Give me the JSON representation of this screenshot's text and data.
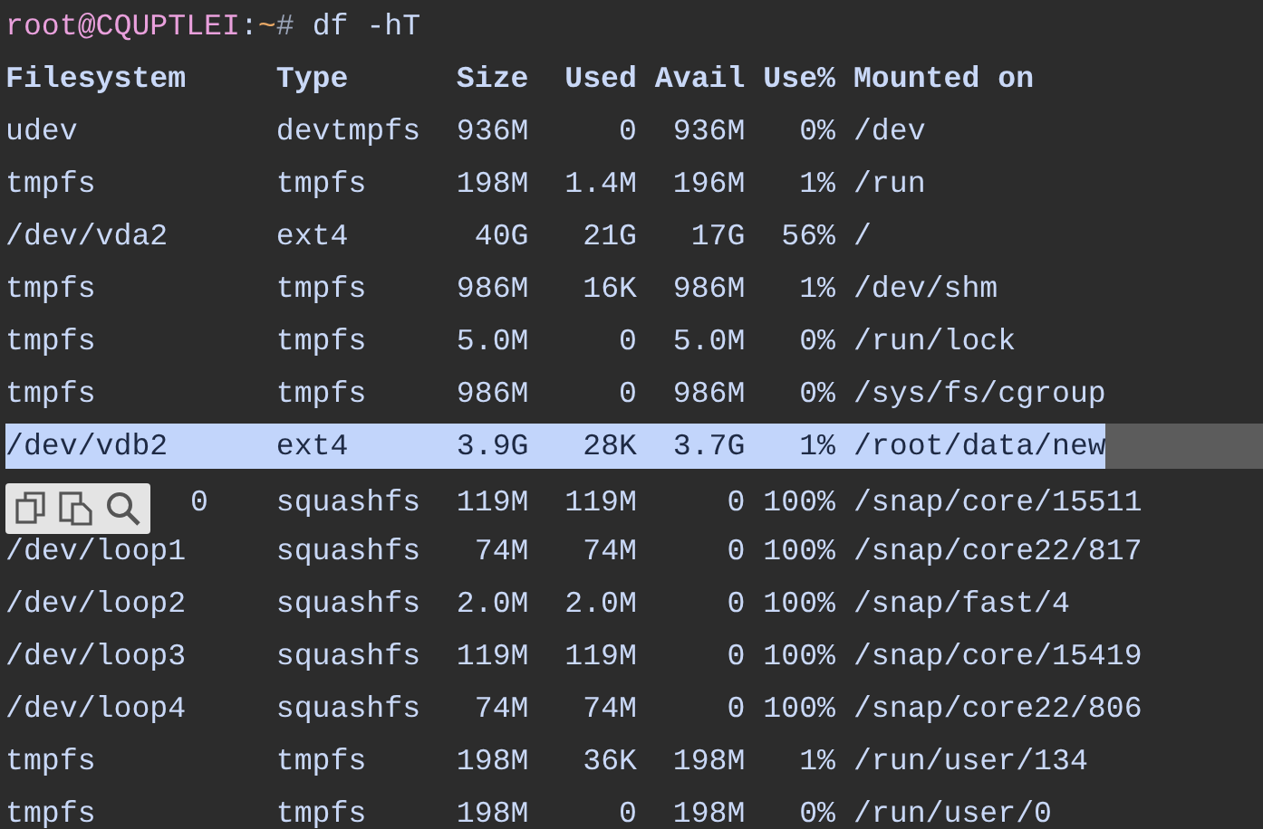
{
  "prompt": {
    "user_host": "root@CQUPTLEI",
    "separator": ":",
    "path": "~",
    "symbol": "#",
    "command": "df -hT"
  },
  "table": {
    "columns": [
      "Filesystem",
      "Type",
      "Size",
      "Used",
      "Avail",
      "Use%",
      "Mounted on"
    ],
    "rows": [
      {
        "cells": [
          "udev",
          "devtmpfs",
          "936M",
          "0",
          "936M",
          "0%",
          "/dev"
        ],
        "selected": false
      },
      {
        "cells": [
          "tmpfs",
          "tmpfs",
          "198M",
          "1.4M",
          "196M",
          "1%",
          "/run"
        ],
        "selected": false
      },
      {
        "cells": [
          "/dev/vda2",
          "ext4",
          "40G",
          "21G",
          "17G",
          "56%",
          "/"
        ],
        "selected": false
      },
      {
        "cells": [
          "tmpfs",
          "tmpfs",
          "986M",
          "16K",
          "986M",
          "1%",
          "/dev/shm"
        ],
        "selected": false
      },
      {
        "cells": [
          "tmpfs",
          "tmpfs",
          "5.0M",
          "0",
          "5.0M",
          "0%",
          "/run/lock"
        ],
        "selected": false
      },
      {
        "cells": [
          "tmpfs",
          "tmpfs",
          "986M",
          "0",
          "986M",
          "0%",
          "/sys/fs/cgroup"
        ],
        "selected": false
      },
      {
        "cells": [
          "/dev/vdb2",
          "ext4",
          "3.9G",
          "28K",
          "3.7G",
          "1%",
          "/root/data/new"
        ],
        "selected": true
      },
      {
        "cells": [
          "0",
          "squashfs",
          "119M",
          "119M",
          "0",
          "100%",
          "/snap/core/15511"
        ],
        "selected": false,
        "kind": "under_toolbar"
      },
      {
        "cells": [
          "/dev/loop1",
          "squashfs",
          "74M",
          "74M",
          "0",
          "100%",
          "/snap/core22/817"
        ],
        "selected": false
      },
      {
        "cells": [
          "/dev/loop2",
          "squashfs",
          "2.0M",
          "2.0M",
          "0",
          "100%",
          "/snap/fast/4"
        ],
        "selected": false
      },
      {
        "cells": [
          "/dev/loop3",
          "squashfs",
          "119M",
          "119M",
          "0",
          "100%",
          "/snap/core/15419"
        ],
        "selected": false
      },
      {
        "cells": [
          "/dev/loop4",
          "squashfs",
          "74M",
          "74M",
          "0",
          "100%",
          "/snap/core22/806"
        ],
        "selected": false
      },
      {
        "cells": [
          "tmpfs",
          "tmpfs",
          "198M",
          "36K",
          "198M",
          "1%",
          "/run/user/134"
        ],
        "selected": false
      },
      {
        "cells": [
          "tmpfs",
          "tmpfs",
          "198M",
          "0",
          "198M",
          "0%",
          "/run/user/0"
        ],
        "selected": false
      }
    ]
  }
}
